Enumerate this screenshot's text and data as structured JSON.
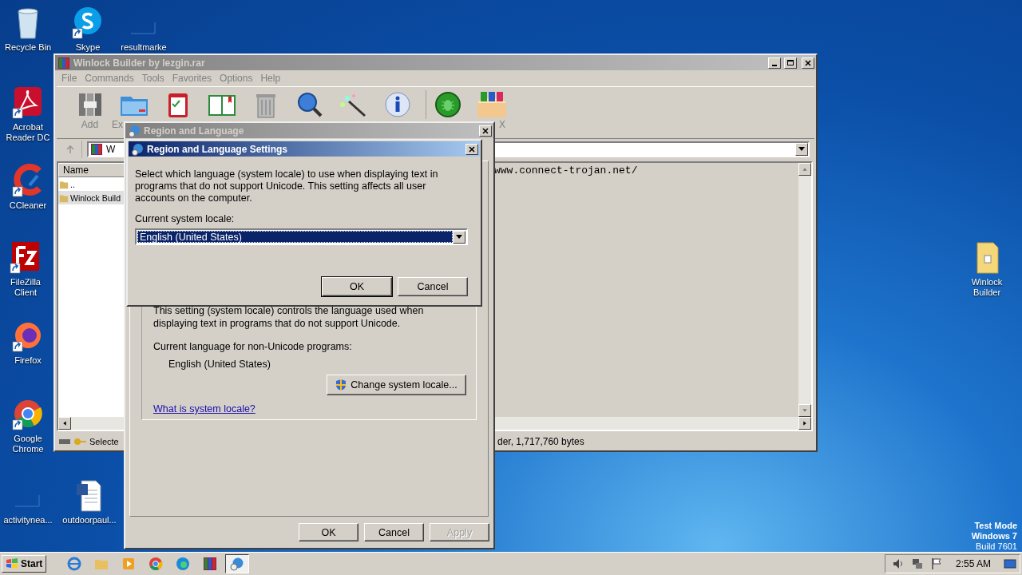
{
  "desktop": {
    "icons": [
      {
        "label": "Recycle Bin",
        "kind": "recycle",
        "shortcut": false
      },
      {
        "label": "Skype",
        "kind": "skype",
        "shortcut": true
      },
      {
        "label": "resultmarke",
        "kind": "blank",
        "shortcut": false
      },
      {
        "label": "Acrobat Reader DC",
        "kind": "acrobat",
        "shortcut": true
      },
      {
        "label": "CCleaner",
        "kind": "ccleaner",
        "shortcut": true
      },
      {
        "label": "FileZilla Client",
        "kind": "filezilla",
        "shortcut": true
      },
      {
        "label": "Firefox",
        "kind": "firefox",
        "shortcut": true
      },
      {
        "label": "Google Chrome",
        "kind": "chrome",
        "shortcut": true
      },
      {
        "label": "activitynea...",
        "kind": "blank",
        "shortcut": false
      },
      {
        "label": "outdoorpaul...",
        "kind": "word",
        "shortcut": false
      },
      {
        "label": "Winlock Builder",
        "kind": "folder",
        "shortcut": false
      }
    ],
    "mode_lines": [
      {
        "text": "Test Mode",
        "bold": true
      },
      {
        "text": "Windows 7",
        "bold": true
      },
      {
        "text": "Build 7601",
        "bold": false
      }
    ]
  },
  "archive_window": {
    "title": "Winlock Builder by lezgin.rar",
    "active": false,
    "menu": [
      "File",
      "Commands",
      "Tools",
      "Favorites",
      "Options",
      "Help"
    ],
    "toolbar": [
      {
        "kind": "add",
        "label": "Add"
      },
      {
        "kind": "extract",
        "label": "Ex"
      },
      {
        "kind": "test"
      },
      {
        "kind": "view"
      },
      {
        "kind": "delete"
      },
      {
        "kind": "find"
      },
      {
        "kind": "wizard"
      },
      {
        "kind": "info"
      },
      {
        "kind": "virus"
      },
      {
        "kind": "sfx",
        "label": "X"
      }
    ],
    "path": "W",
    "column": "Name",
    "rows": [
      {
        "name": "..",
        "selected": false
      },
      {
        "name": "Winlock Build",
        "selected": true
      }
    ],
    "comment": "www.connect-trojan.net/",
    "status_left": "Selecte",
    "status_right": "der, 1,717,760 bytes"
  },
  "region_dialog": {
    "title": "Region and Language",
    "group_text": "This setting (system locale) controls the language used when displaying text in programs that do not support Unicode.",
    "current_label": "Current language for non-Unicode programs:",
    "current_value": "English (United States)",
    "change_button": "Change system locale...",
    "link": "What is system locale?",
    "buttons": [
      {
        "label": "OK",
        "disabled": false
      },
      {
        "label": "Cancel",
        "disabled": false
      },
      {
        "label": "Apply",
        "disabled": true
      }
    ]
  },
  "locale_dialog": {
    "title": "Region and Language Settings",
    "description": "Select which language (system locale) to use when displaying text in programs that do not support Unicode. This setting affects all user accounts on the computer.",
    "field_label": "Current system locale:",
    "value": "English (United States)",
    "buttons": [
      {
        "label": "OK",
        "default": true
      },
      {
        "label": "Cancel",
        "default": false
      }
    ]
  },
  "taskbar": {
    "start": "Start",
    "apps": [
      {
        "kind": "ie",
        "selected": false
      },
      {
        "kind": "explorer",
        "selected": false
      },
      {
        "kind": "media",
        "selected": false
      },
      {
        "kind": "chrome",
        "selected": false
      },
      {
        "kind": "edge",
        "selected": false
      },
      {
        "kind": "winrar",
        "selected": false
      },
      {
        "kind": "globe",
        "selected": true
      }
    ],
    "time": "2:55 AM"
  }
}
